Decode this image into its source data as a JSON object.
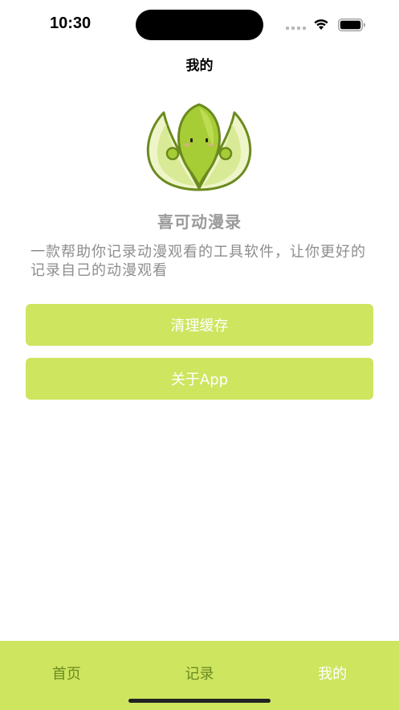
{
  "status_bar": {
    "time": "10:30",
    "icons": [
      "signal-icon",
      "wifi-icon",
      "battery-icon"
    ]
  },
  "nav": {
    "title": "我的"
  },
  "profile": {
    "app_name": "喜可动漫录",
    "description": "一款帮助你记录动漫观看的工具软件，让你更好的记录自己的动漫观看"
  },
  "actions": {
    "clear_cache": "清理缓存",
    "about": "关于App"
  },
  "tab_bar": {
    "items": [
      {
        "label": "首页",
        "active": false
      },
      {
        "label": "记录",
        "active": false
      },
      {
        "label": "我的",
        "active": true
      }
    ]
  },
  "colors": {
    "accent": "#cde55f",
    "tab_inactive": "#6b8a1f",
    "tab_active": "#ffffff",
    "secondary_text": "#9a9a9a"
  }
}
